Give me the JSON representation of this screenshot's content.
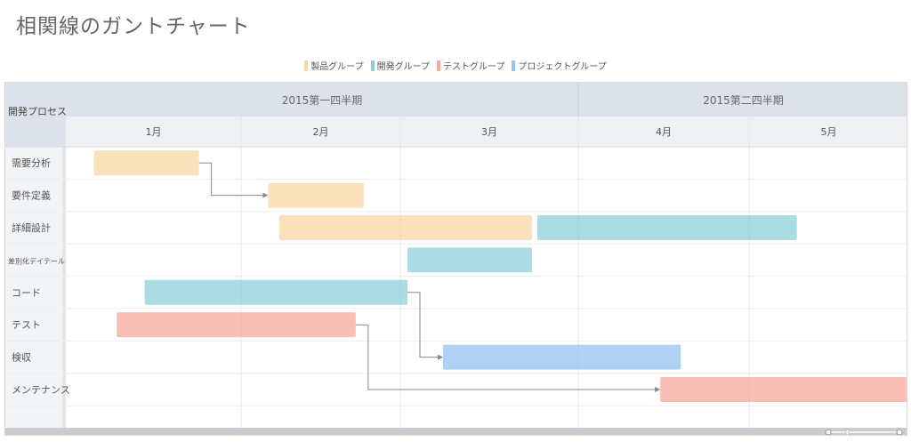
{
  "title": "相関線のガントチャート",
  "legend": [
    {
      "label": "製品グループ",
      "color": "#f7d7a5"
    },
    {
      "label": "開発グループ",
      "color": "#8fd0d8"
    },
    {
      "label": "テストグループ",
      "color": "#f5a99e"
    },
    {
      "label": "プロジェクトグループ",
      "color": "#94c2ef"
    }
  ],
  "chart_data": {
    "type": "gantt",
    "corner_label": "開発プロセス",
    "quarters": [
      {
        "label": "2015第一四半期",
        "start": 0,
        "end": 3
      },
      {
        "label": "2015第二四半期",
        "start": 3,
        "end": 5
      }
    ],
    "months": [
      "1月",
      "2月",
      "3月",
      "4月",
      "5月"
    ],
    "categories": [
      "需要分析",
      "要件定義",
      "詳細設計",
      "差別化デイテール",
      "コード",
      "テスト",
      "検収",
      "メンテナンス"
    ],
    "tasks": [
      {
        "category": "需要分析",
        "start": 0.16,
        "end": 0.76,
        "group": "製品グループ"
      },
      {
        "category": "要件定義",
        "start": 1.17,
        "end": 1.77,
        "group": "製品グループ"
      },
      {
        "category": "詳細設計",
        "start": 1.24,
        "end": 2.74,
        "group": "製品グループ"
      },
      {
        "category": "詳細設計",
        "start": 2.77,
        "end": 4.3,
        "group": "開発グループ"
      },
      {
        "category": "差別化デイテール",
        "start": 2.04,
        "end": 2.74,
        "group": "開発グループ"
      },
      {
        "category": "コード",
        "start": 0.45,
        "end": 2.04,
        "group": "開発グループ"
      },
      {
        "category": "テスト",
        "start": 0.29,
        "end": 1.72,
        "group": "テストグループ"
      },
      {
        "category": "検収",
        "start": 2.24,
        "end": 3.6,
        "group": "プロジェクトグループ"
      },
      {
        "category": "メンテナンス",
        "start": 3.48,
        "end": 5.0,
        "group": "テストグループ"
      }
    ],
    "links": [
      {
        "from": "需要分析",
        "to": "要件定義"
      },
      {
        "from": "コード",
        "to": "検収"
      },
      {
        "from": "テスト",
        "to": "メンテナンス"
      }
    ]
  }
}
